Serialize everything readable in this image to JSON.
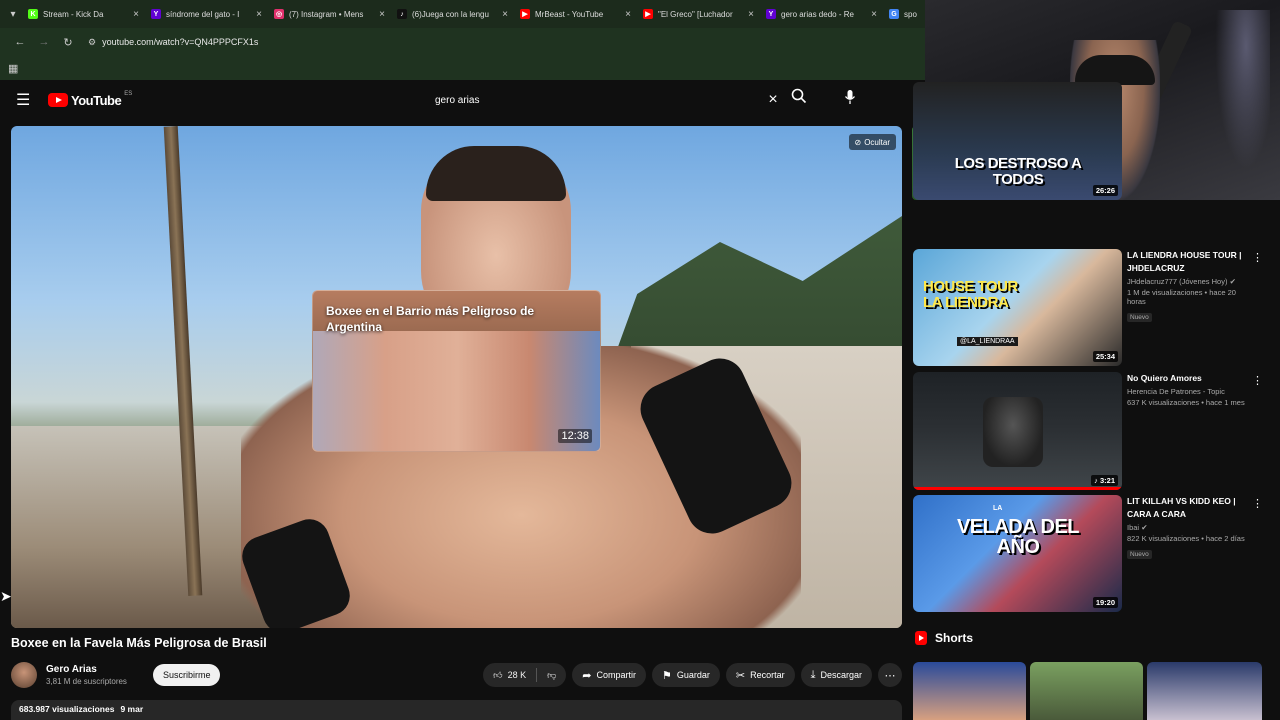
{
  "browser": {
    "tabs": [
      {
        "title": "Stream - Kick Da",
        "icon": "kick-icon",
        "color": "#53fc18",
        "letter": "K"
      },
      {
        "title": "síndrome del gato - I",
        "icon": "yahoo-icon",
        "color": "#6001d2",
        "letter": "Y"
      },
      {
        "title": "(7) Instagram • Mens",
        "icon": "instagram-icon",
        "color": "#e1306c",
        "letter": "◎"
      },
      {
        "title": "(6)Juega con la lengu",
        "icon": "tiktok-icon",
        "color": "#111111",
        "letter": "♪"
      },
      {
        "title": "MrBeast - YouTube",
        "icon": "youtube-icon",
        "color": "#ff0000",
        "letter": "▶"
      },
      {
        "title": "\"El Greco\" [Luchador",
        "icon": "youtube-icon",
        "color": "#ff0000",
        "letter": "▶"
      },
      {
        "title": "gero arias dedo - Re",
        "icon": "yahoo-icon",
        "color": "#6001d2",
        "letter": "Y"
      },
      {
        "title": "spo",
        "icon": "google-icon",
        "color": "#4285f4",
        "letter": "G"
      }
    ],
    "close_glyph": "×",
    "url": "youtube.com/watch?v=QN4PPPCFX1s"
  },
  "youtube": {
    "logo_text": "YouTube",
    "country_code": "ES",
    "search_value": "gero arias",
    "ocultar_label": "Ocultar",
    "endcard": {
      "title": "Boxee en el Barrio más Peligroso de Argentina",
      "duration": "12:38"
    },
    "video": {
      "title": "Boxee en la Favela Más Peligrosa de Brasil",
      "channel": "Gero Arias",
      "subscribers": "3,81 M de suscriptores",
      "subscribe_label": "Suscribirme",
      "likes": "28 K",
      "share_label": "Compartir",
      "save_label": "Guardar",
      "clip_label": "Recortar",
      "download_label": "Descargar",
      "views": "683.987 visualizaciones",
      "date": "9 mar"
    },
    "recommendations": [
      {
        "title": "",
        "channel": "",
        "stats": "",
        "badge": "",
        "duration": "26:26",
        "thumb_text": "LOS DESTROSO A TODOS"
      },
      {
        "title": "LA LIENDRA HOUSE TOUR | JHDELACRUZ",
        "channel": "JHdelacruz777 (Jóvenes Hoy)",
        "stats": "1 M de visualizaciones • hace 20 horas",
        "badge": "Nuevo",
        "duration": "25:34",
        "thumb_text": "HOUSE TOUR LA LIENDRA",
        "thumb_sub": "@LA_LIENDRAA"
      },
      {
        "title": "No Quiero Amores",
        "channel": "Herencia De Patrones - Topic",
        "stats": "637 K visualizaciones • hace 1 mes",
        "badge": "",
        "duration": "3:21",
        "thumb_text": ""
      },
      {
        "title": "LIT KILLAH VS KIDD KEO | CARA A CARA",
        "channel": "Ibai",
        "stats": "822 K visualizaciones • hace 2 días",
        "badge": "Nuevo",
        "duration": "19:20",
        "thumb_text": "VELADA DEL AÑO",
        "thumb_sub": "LA"
      }
    ],
    "shorts_label": "Shorts"
  }
}
